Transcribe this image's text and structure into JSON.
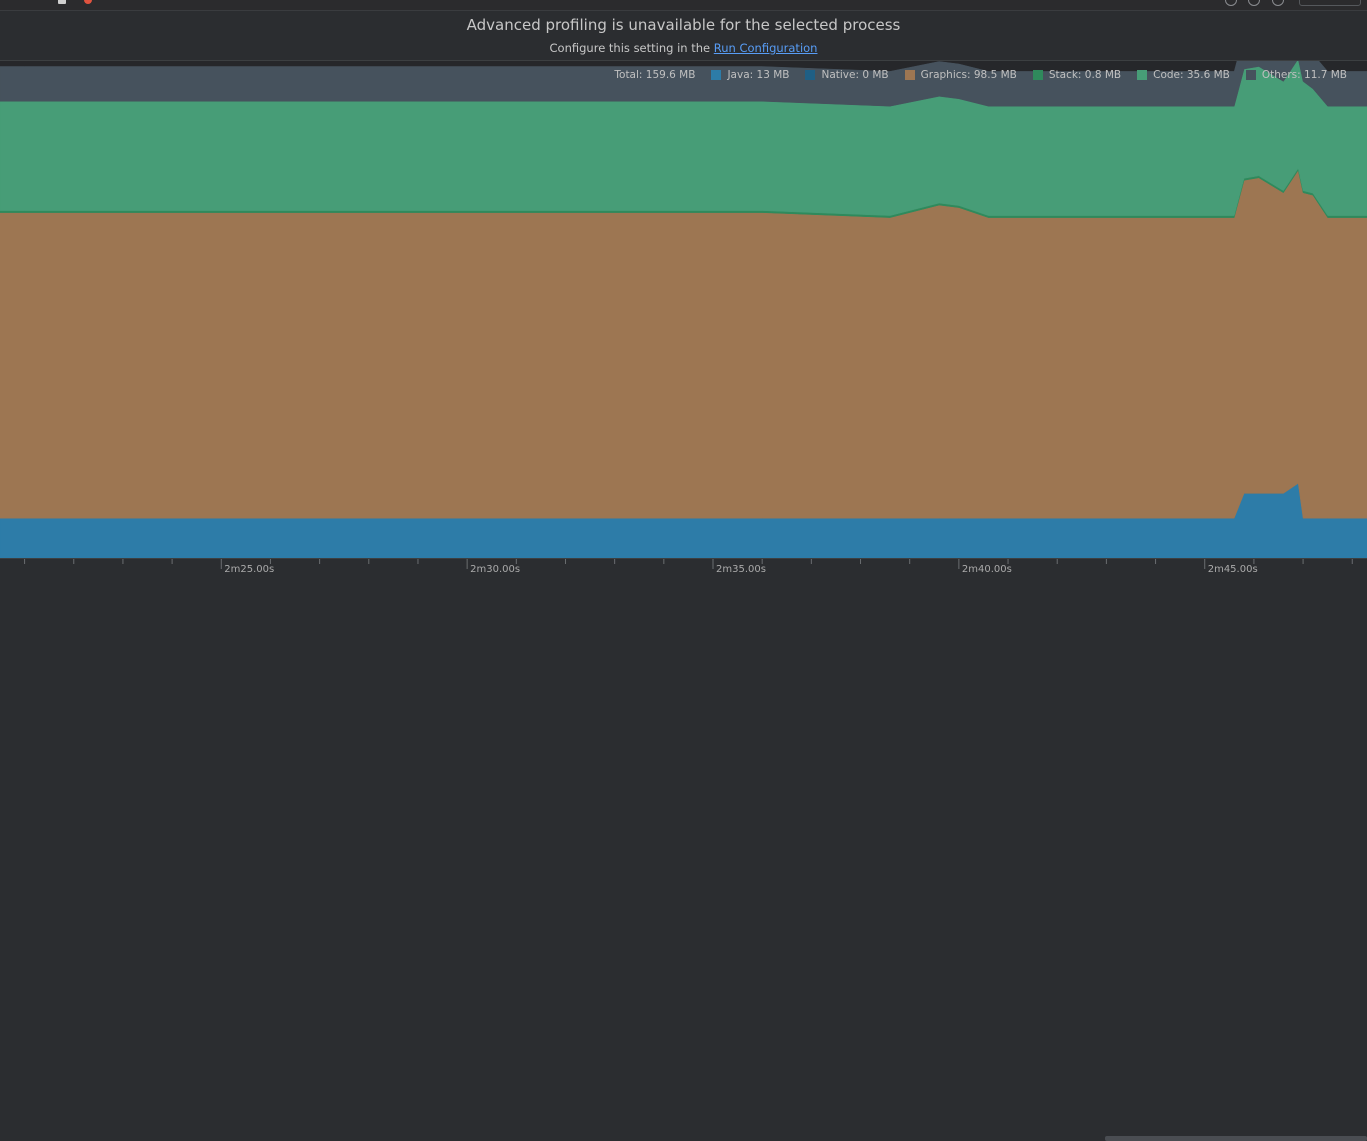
{
  "banner": {
    "title": "Advanced profiling is unavailable for the selected process",
    "subtitle_prefix": "Configure this setting in the",
    "link": "Run Configuration"
  },
  "legend": [
    {
      "label": "Total: 159.6 MB",
      "color": ""
    },
    {
      "label": "Java: 13 MB",
      "color": "#2d7ca8"
    },
    {
      "label": "Native: 0 MB",
      "color": "#1f5f85"
    },
    {
      "label": "Graphics: 98.5 MB",
      "color": "#9d7652"
    },
    {
      "label": "Stack: 0.8 MB",
      "color": "#2f8a5c"
    },
    {
      "label": "Code: 35.6 MB",
      "color": "#479d77"
    },
    {
      "label": "Others: 11.7 MB",
      "color": "#46525d"
    }
  ],
  "colors": {
    "java": "#2d7ca8",
    "graphics": "#9d7652",
    "stack": "#2f8a5c",
    "code": "#479d77",
    "others": "#46525d"
  },
  "axis": {
    "ticks": [
      "2m25.00s",
      "2m30.00s",
      "2m35.00s",
      "2m40.00s",
      "2m45.00s"
    ]
  },
  "chart_data": {
    "type": "area",
    "stacked": true,
    "x_unit": "s",
    "xlim": [
      140.5,
      168.3
    ],
    "ylabel": "",
    "ylim": [
      0,
      200
    ],
    "x": [
      140.5,
      141.0,
      156.0,
      158.6,
      159.6,
      160.0,
      160.6,
      161.0,
      165.6,
      165.8,
      166.1,
      166.6,
      166.9,
      167.0,
      167.2,
      167.5,
      168.3
    ],
    "series": [
      {
        "name": "Java",
        "values": [
          16.0,
          16.0,
          16.0,
          16.0,
          16.0,
          16.0,
          16.0,
          16.0,
          16.0,
          26.0,
          26.0,
          26.0,
          30.0,
          16.0,
          16.0,
          16.0,
          16.0
        ]
      },
      {
        "name": "Graphics",
        "values": [
          123.0,
          123.0,
          123.0,
          121.0,
          126.0,
          125.0,
          121.0,
          121.0,
          121.0,
          126.0,
          127.0,
          121.0,
          126.0,
          131.0,
          130.0,
          121.0,
          121.0
        ]
      },
      {
        "name": "Stack",
        "values": [
          0.8,
          0.8,
          0.8,
          0.8,
          0.8,
          0.8,
          0.8,
          0.8,
          0.8,
          0.8,
          0.8,
          0.8,
          0.8,
          0.8,
          0.8,
          0.8,
          0.8
        ]
      },
      {
        "name": "Code",
        "values": [
          44.0,
          44.0,
          44.0,
          44.0,
          43.0,
          43.0,
          44.0,
          44.0,
          44.0,
          44.0,
          44.0,
          44.0,
          44.0,
          44.0,
          42.0,
          44.0,
          44.0
        ]
      },
      {
        "name": "Others",
        "values": [
          14.0,
          14.0,
          14.0,
          14.0,
          14.0,
          14.0,
          14.0,
          14.0,
          14.0,
          14.0,
          14.0,
          14.0,
          14.0,
          14.0,
          14.0,
          14.0,
          14.0
        ]
      }
    ],
    "x_ticks": [
      145,
      150,
      155,
      160,
      165
    ],
    "x_tick_labels": [
      "2m25.00s",
      "2m30.00s",
      "2m35.00s",
      "2m40.00s",
      "2m45.00s"
    ]
  }
}
